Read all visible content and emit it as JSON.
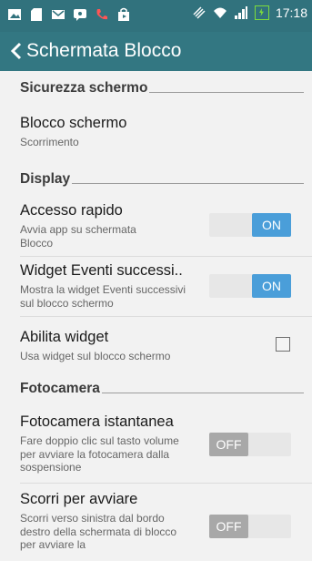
{
  "status_bar": {
    "time": "17:18",
    "left_icons": [
      "image-icon",
      "sd-card-icon",
      "email-icon",
      "chat-icon",
      "phone-icon",
      "shopping-bag-icon"
    ],
    "right_icons": [
      "vibrate-icon",
      "wifi-icon",
      "signal-icon",
      "battery-charging-icon"
    ]
  },
  "app_bar": {
    "back_icon": "chevron-left-icon",
    "title": "Schermata Blocco"
  },
  "sections": [
    {
      "header": "Sicurezza schermo",
      "items": [
        {
          "title": "Blocco schermo",
          "subtitle": "Scorrimento"
        }
      ]
    },
    {
      "header": "Display",
      "items": [
        {
          "title": "Accesso rapido",
          "subtitle": "Avvia app su schermata Blocco",
          "control": "toggle",
          "state": "ON"
        },
        {
          "title": "Widget Eventi successi..",
          "subtitle": "Mostra la widget Eventi successivi sul blocco schermo",
          "control": "toggle",
          "state": "ON"
        },
        {
          "title": "Abilita widget",
          "subtitle": "Usa widget sul blocco schermo",
          "control": "checkbox",
          "checked": false
        }
      ]
    },
    {
      "header": "Fotocamera",
      "items": [
        {
          "title": "Fotocamera istantanea",
          "subtitle": "Fare doppio clic sul tasto volume per avviare la fotocamera dalla sospensione",
          "control": "toggle",
          "state": "OFF"
        },
        {
          "title": "Scorri per avviare",
          "subtitle": "Scorri verso sinistra dal bordo destro della schermata di blocco per avviare la",
          "control": "toggle",
          "state": "OFF"
        }
      ]
    }
  ],
  "colors": {
    "status_bar": "#31727d",
    "app_bar": "#337782",
    "toggle_on": "#4a9ed9",
    "toggle_off": "#a8a8a8",
    "background": "#f2f2f2"
  }
}
